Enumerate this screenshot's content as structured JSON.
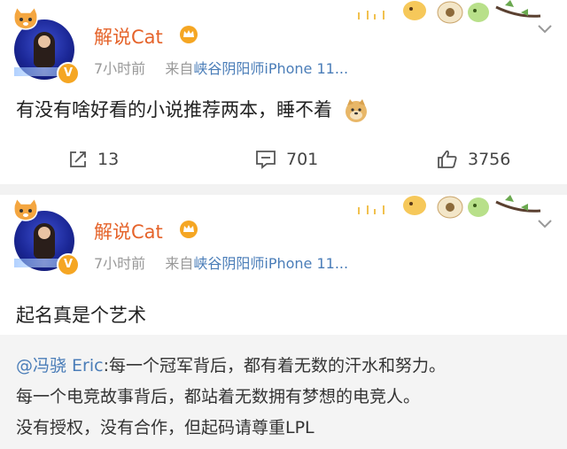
{
  "posts": [
    {
      "username": "解说Cat",
      "time": "7小时前",
      "source_prefix": "来自",
      "source": "峡谷阴阳师iPhone 11...",
      "content": "有没有啥好看的小说推荐两本，睡不着",
      "emoji": "doge-icon",
      "actions": {
        "repost": "13",
        "comment": "701",
        "like": "3756"
      }
    },
    {
      "username": "解说Cat",
      "time": "7小时前",
      "source_prefix": "来自",
      "source": "峡谷阴阳师iPhone 11...",
      "content": "起名真是个艺术",
      "retweet": {
        "mention": "@冯骁 Eric",
        "line1": ":每一个冠军背后，都有着无数的汗水和努力。",
        "line2": "每一个电竞故事背后，都站着无数拥有梦想的电竞人。",
        "line3": "没有授权，没有合作，但起码请尊重LPL"
      }
    }
  ],
  "colors": {
    "username": "#e5632a",
    "link": "#4a7db8",
    "meta": "#999999"
  }
}
